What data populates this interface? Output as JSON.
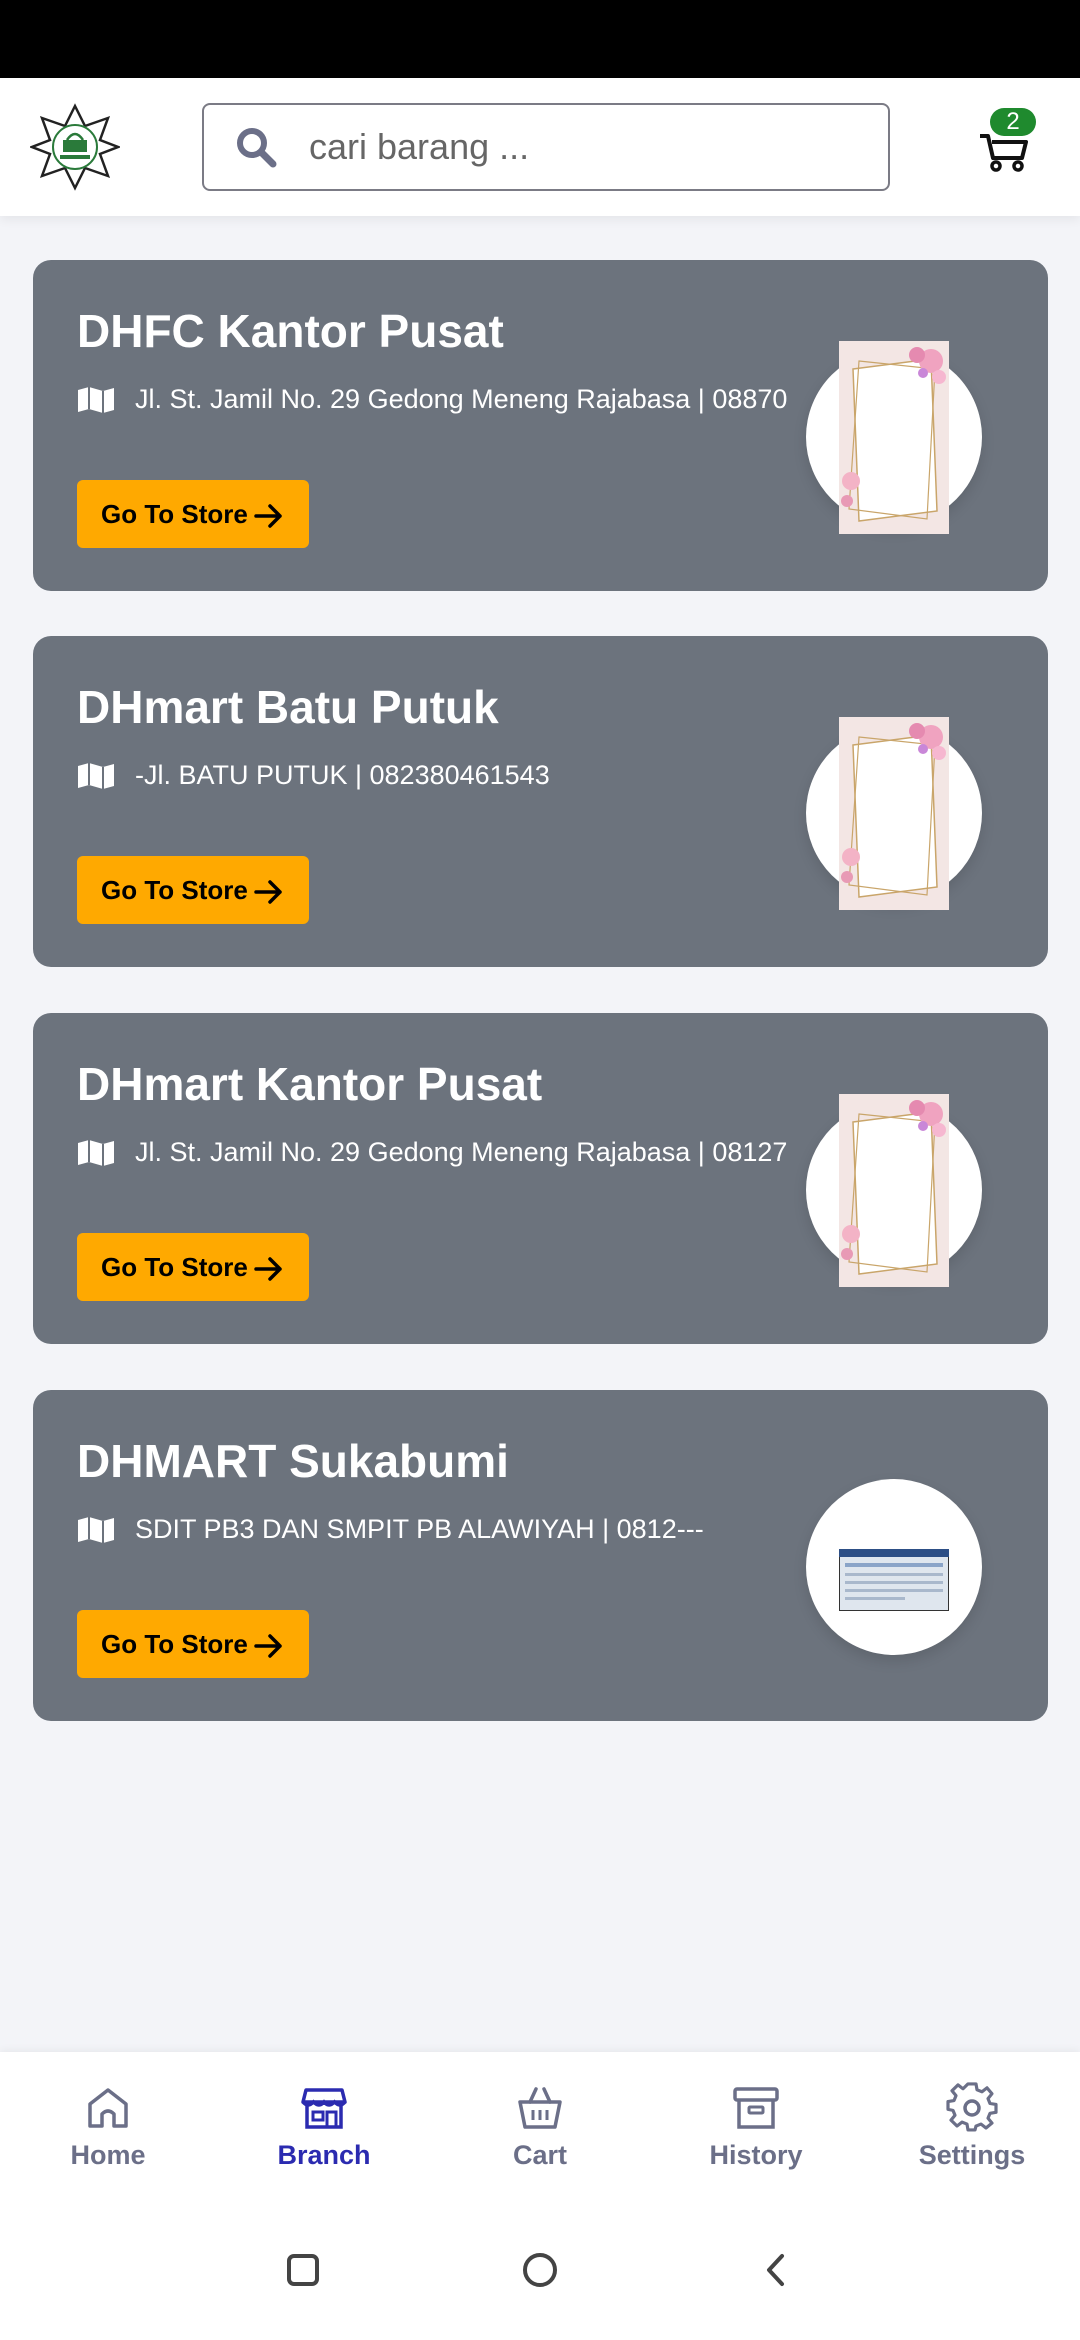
{
  "search": {
    "placeholder": "cari barang ..."
  },
  "cart": {
    "badge_count": "2"
  },
  "stores": [
    {
      "name": "DHFC Kantor Pusat",
      "address": "Jl. St. Jamil No. 29 Gedong Meneng Rajabasa | 08870",
      "button": "Go To Store",
      "thumbnail": "floral-frame"
    },
    {
      "name": "DHmart Batu Putuk",
      "address": "-Jl. BATU PUTUK | 082380461543",
      "button": "Go To Store",
      "thumbnail": "floral-frame"
    },
    {
      "name": "DHmart Kantor Pusat",
      "address": "Jl. St. Jamil No. 29 Gedong Meneng Rajabasa | 08127",
      "button": "Go To Store",
      "thumbnail": "floral-frame"
    },
    {
      "name": "DHMART Sukabumi",
      "address": "SDIT PB3 DAN SMPIT PB ALAWIYAH | 0812---",
      "button": "Go To Store",
      "thumbnail": "screenshot-image"
    }
  ],
  "nav": {
    "items": [
      {
        "label": "Home",
        "icon": "home-icon",
        "active": false
      },
      {
        "label": "Branch",
        "icon": "store-icon",
        "active": true
      },
      {
        "label": "Cart",
        "icon": "basket-icon",
        "active": false
      },
      {
        "label": "History",
        "icon": "archive-icon",
        "active": false
      },
      {
        "label": "Settings",
        "icon": "gear-icon",
        "active": false
      }
    ]
  },
  "colors": {
    "card_bg": "#6c737d",
    "button_accent": "#ffa900",
    "nav_active": "#2b2bb0",
    "nav_inactive": "#6b6f88",
    "badge": "#1f8a2e"
  }
}
